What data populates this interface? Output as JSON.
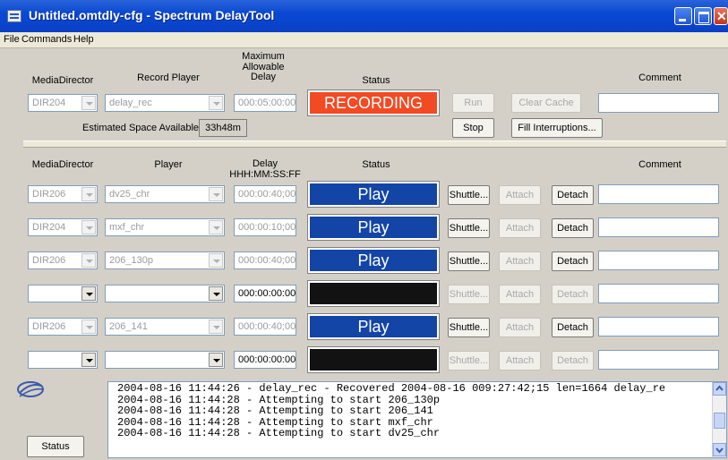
{
  "window": {
    "title": "Untitled.omtdly-cfg - Spectrum DelayTool"
  },
  "menu": [
    "File",
    "Commands",
    "Help"
  ],
  "record": {
    "headers": {
      "media_director": "MediaDirector",
      "record_player": "Record Player",
      "max_delay": "Maximum\nAllowable\nDelay",
      "status": "Status",
      "comment": "Comment"
    },
    "media_director": "DIR204",
    "player": "delay_rec",
    "max_delay": "000:05:00:00",
    "status": "RECORDING",
    "status_color": "#f24a23",
    "comment": "",
    "space_label": "Estimated Space Available:",
    "space_value": "33h48m",
    "buttons": {
      "run": "Run",
      "stop": "Stop",
      "clear_cache": "Clear Cache",
      "fill_interruptions": "Fill Interruptions..."
    }
  },
  "players": {
    "headers": {
      "media_director": "MediaDirector",
      "player": "Player",
      "delay": "Delay\nHHH:MM:SS:FF",
      "status": "Status",
      "comment": "Comment"
    },
    "buttons": {
      "shuttle": "Shuttle...",
      "attach": "Attach",
      "detach": "Detach"
    },
    "play_color": "#1345a6",
    "rows": [
      {
        "media_director": "DIR206",
        "player": "dv25_chr",
        "delay": "000:00:40;00",
        "status": "Play",
        "enabled": false
      },
      {
        "media_director": "DIR204",
        "player": "mxf_chr",
        "delay": "000:00:10;00",
        "status": "Play",
        "enabled": false
      },
      {
        "media_director": "DIR206",
        "player": "206_130p",
        "delay": "000:00:40;00",
        "status": "Play",
        "enabled": false
      },
      {
        "media_director": "",
        "player": "",
        "delay": "000:00:00:00",
        "status": "",
        "enabled": true
      },
      {
        "media_director": "DIR206",
        "player": "206_141",
        "delay": "000:00:40;00",
        "status": "Play",
        "enabled": false
      },
      {
        "media_director": "",
        "player": "",
        "delay": "000:00:00:00",
        "status": "",
        "enabled": true
      }
    ]
  },
  "status_button": "Status",
  "log": {
    "lines": [
      "2004-08-16 11:44:26 - delay_rec - Recovered 2004-08-16 009:27:42;15 len=1664 delay_re",
      "2004-08-16 11:44:28 - Attempting to start 206_130p",
      "2004-08-16 11:44:28 - Attempting to start 206_141",
      "2004-08-16 11:44:28 - Attempting to start mxf_chr",
      "2004-08-16 11:44:28 - Attempting to start dv25_chr"
    ]
  }
}
